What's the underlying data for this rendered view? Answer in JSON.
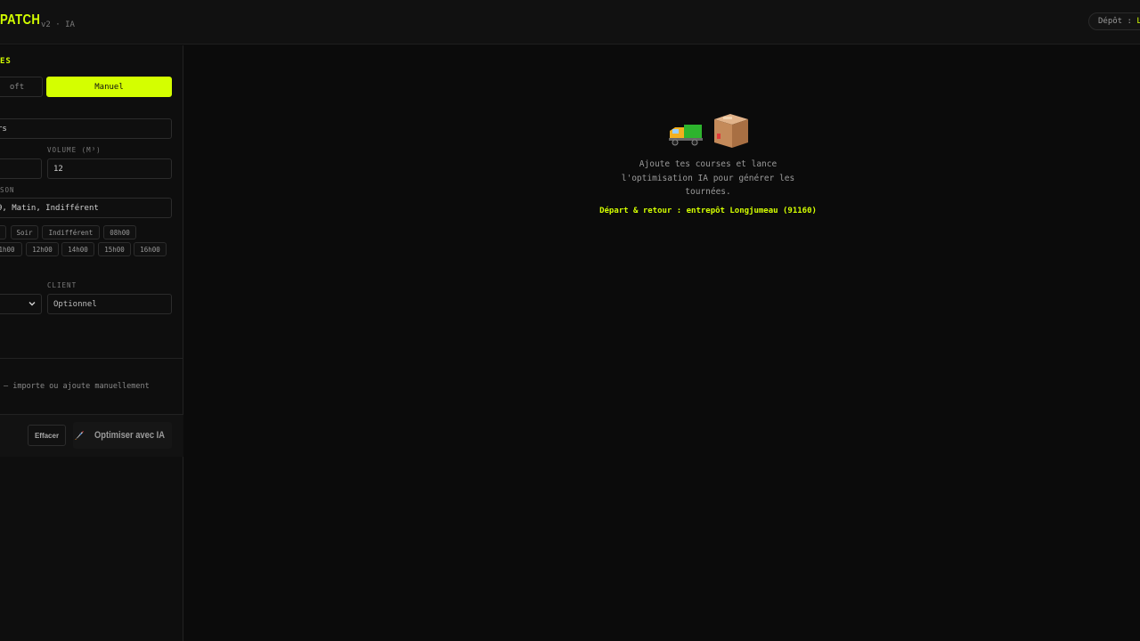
{
  "header": {
    "brand": "PATCH",
    "meta": "v2 · IA",
    "depot_label": "Dépôt :",
    "depot_value": "Lo"
  },
  "sidebar": {
    "section_title": "ES",
    "mode_soft": "oft",
    "mode_manual": "Manuel",
    "address_value": "rs",
    "volume_label": "VOLUME (M³)",
    "volume_value": "12",
    "qty_value": "",
    "slot_label": "SON",
    "slot_value": "9, Matin, Indifférent",
    "chips_row1": [
      ".",
      "Soir",
      "Indifférent",
      "08h00"
    ],
    "chips_row2": [
      "1h00",
      "12h00",
      "14h00",
      "15h00",
      "16h00"
    ],
    "client_label": "CLIENT",
    "client_placeholder": "Optionnel",
    "empty_hint": "— importe ou ajoute manuellement",
    "clear_button": "Effacer",
    "optimize_button": "Optimiser avec IA"
  },
  "main": {
    "empty_text": "Ajoute tes courses et lance l'optimisation IA pour générer les tournées.",
    "depot_line": "Départ & retour : entrepôt Longjumeau (91160)"
  },
  "icons": {
    "truck": "truck-icon",
    "box": "package-icon",
    "rocket": "rocket-icon",
    "chevron": "chevron-down-icon"
  },
  "colors": {
    "accent": "#d4ff00",
    "background": "#0b0b0b",
    "panel": "#0e0e0e"
  }
}
